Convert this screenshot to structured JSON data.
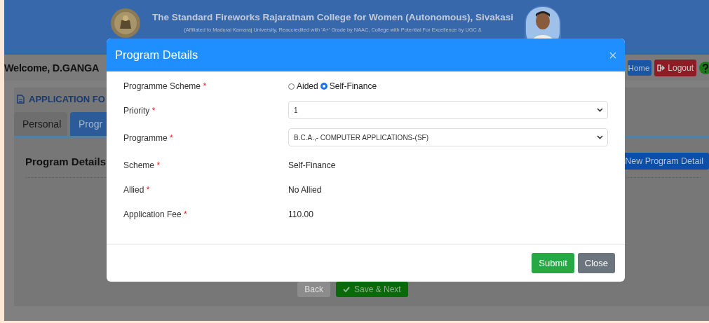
{
  "header": {
    "title": "The Standard Fireworks Rajaratnam College for Women (Autonomous), Sivakasi",
    "subtitle": "(Affiliated to Madurai Kamaraj University, Reaccredited with 'A+' Grade by NAAC, College with Potential For Excellence by UGC &"
  },
  "welcome_bar": {
    "greeting": "Welcome, D.GANGA",
    "buttons": [
      {
        "label": "Home",
        "kind": "home"
      },
      {
        "label": "Logout",
        "kind": "logout"
      }
    ]
  },
  "application": {
    "heading": "APPLICATION FO",
    "tabs": [
      {
        "label": "Personal",
        "selected": false
      },
      {
        "label": "Progr",
        "selected": true
      }
    ],
    "section_title": "Program Details",
    "add_button": "New Program Detail",
    "nav_buttons": [
      {
        "label": "Back",
        "kind": "back"
      },
      {
        "label": "Save & Next",
        "kind": "next"
      }
    ]
  },
  "modal": {
    "title": "Program Details",
    "fields": [
      {
        "label": "Programme Scheme",
        "required": "*",
        "kind": "radio",
        "options": [
          {
            "label": "Aided",
            "selected": false
          },
          {
            "label": "Self-Finance",
            "selected": true
          }
        ]
      },
      {
        "label": "Priority",
        "required": "*",
        "kind": "select",
        "value": "1"
      },
      {
        "label": "Programme",
        "required": "*",
        "kind": "select",
        "value": "B.C.A.,- COMPUTER APPLICATIONS-(SF)"
      },
      {
        "label": "Scheme",
        "required": "*",
        "kind": "text",
        "value": "Self-Finance"
      },
      {
        "label": "Allied",
        "required": "*",
        "kind": "text",
        "value": "No Allied"
      },
      {
        "label": "Application Fee",
        "required": "*",
        "kind": "text",
        "value": "110.00"
      }
    ],
    "buttons": [
      {
        "label": "Submit",
        "kind": "primary"
      },
      {
        "label": "Close",
        "kind": "secondary"
      }
    ]
  }
}
